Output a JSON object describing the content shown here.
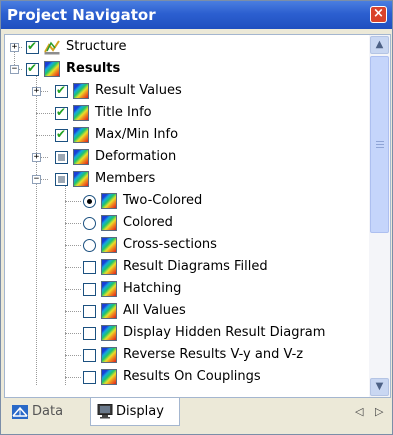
{
  "window": {
    "title": "Project Navigator",
    "close_label": "×"
  },
  "tree": [
    {
      "label": "Structure",
      "bold": false
    },
    {
      "label": "Results",
      "bold": true
    },
    {
      "label": "Result Values",
      "bold": false
    },
    {
      "label": "Title Info",
      "bold": false
    },
    {
      "label": "Max/Min Info",
      "bold": false
    },
    {
      "label": "Deformation",
      "bold": false
    },
    {
      "label": "Members",
      "bold": false
    },
    {
      "label": "Two-Colored",
      "bold": false
    },
    {
      "label": "Colored",
      "bold": false
    },
    {
      "label": "Cross-sections",
      "bold": false
    },
    {
      "label": "Result Diagrams Filled",
      "bold": false
    },
    {
      "label": "Hatching",
      "bold": false
    },
    {
      "label": "All Values",
      "bold": false
    },
    {
      "label": "Display Hidden Result Diagram",
      "bold": false
    },
    {
      "label": "Reverse Results V-y and V-z",
      "bold": false
    },
    {
      "label": "Results On Couplings",
      "bold": false
    }
  ],
  "tabs": {
    "data_label": "Data",
    "display_label": "Display"
  },
  "expander": {
    "plus": "+",
    "minus": "−"
  },
  "nav": {
    "prev": "◁",
    "next": "▷"
  },
  "scroll": {
    "up": "▲",
    "down": "▼"
  }
}
